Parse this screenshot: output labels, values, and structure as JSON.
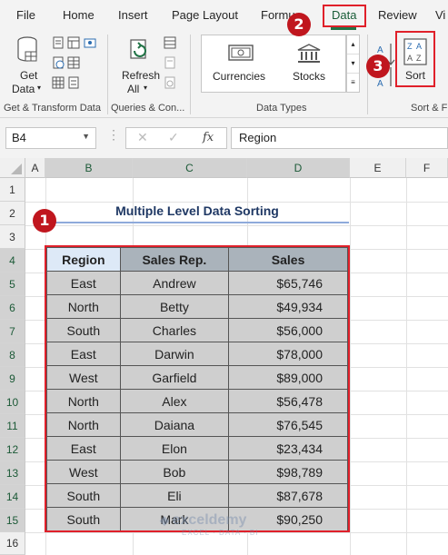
{
  "menu": {
    "tabs": [
      "File",
      "Home",
      "Insert",
      "Page Layout",
      "Formu",
      "Data",
      "Review",
      "Vi"
    ]
  },
  "ribbon": {
    "get_data_line1": "Get",
    "get_data_line2": "Data",
    "refresh_line1": "Refresh",
    "refresh_line2": "All",
    "currencies": "Currencies",
    "stocks": "Stocks",
    "sort": "Sort",
    "group_get_transform": "Get & Transform Data",
    "group_queries": "Queries & Con...",
    "group_data_types": "Data Types",
    "group_sort_filter": "Sort & F"
  },
  "formula_bar": {
    "name_box": "B4",
    "fx": "fx",
    "value": "Region"
  },
  "columns": [
    "A",
    "B",
    "C",
    "D",
    "E",
    "F"
  ],
  "rows": [
    "1",
    "2",
    "3",
    "4",
    "5",
    "6",
    "7",
    "8",
    "9",
    "10",
    "11",
    "12",
    "13",
    "14",
    "15",
    "16"
  ],
  "sheet": {
    "title": "Multiple Level Data Sorting",
    "headers": [
      "Region",
      "Sales Rep.",
      "Sales"
    ],
    "data": [
      [
        "East",
        "Andrew",
        "$65,746"
      ],
      [
        "North",
        "Betty",
        "$49,934"
      ],
      [
        "South",
        "Charles",
        "$56,000"
      ],
      [
        "East",
        "Darwin",
        "$78,000"
      ],
      [
        "West",
        "Garfield",
        "$89,000"
      ],
      [
        "North",
        "Alex",
        "$56,478"
      ],
      [
        "North",
        "Daiana",
        "$76,545"
      ],
      [
        "East",
        "Elon",
        "$23,434"
      ],
      [
        "West",
        "Bob",
        "$98,789"
      ],
      [
        "South",
        "Eli",
        "$87,678"
      ],
      [
        "South",
        "Mark",
        "$90,250"
      ]
    ]
  },
  "badges": [
    "1",
    "2",
    "3"
  ],
  "watermark": {
    "name": "exceldemy",
    "sub": "EXCEL · DATA · BI"
  },
  "colors": {
    "accent_green": "#217346",
    "highlight_red": "#e0202a",
    "badge_red": "#c0161e",
    "title_blue": "#1f3864"
  }
}
